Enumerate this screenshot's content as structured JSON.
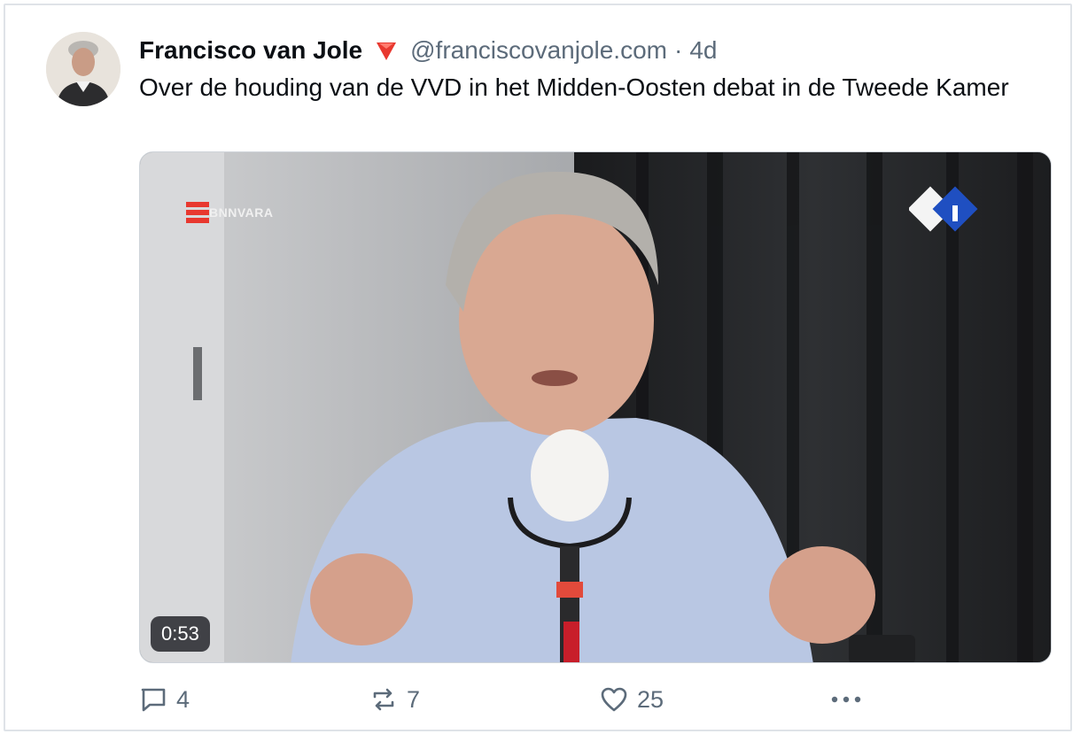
{
  "post": {
    "author": "Francisco van Jole",
    "handle": "@franciscovanjole.com",
    "separator": "·",
    "age": "4d",
    "text": "Over de houding van de VVD in het Midden-Oosten debat in de Tweede Kamer",
    "flag_color": "#e8382f"
  },
  "video": {
    "duration": "0:53",
    "watermark_left": "BNNVARA",
    "watermark_right_icon": "npo-radio-1-logo"
  },
  "actions": {
    "reply_count": "4",
    "repost_count": "7",
    "like_count": "25",
    "more_icon": "ellipsis-icon"
  },
  "colors": {
    "text": "#0b0f14",
    "muted": "#5c6b7a",
    "border": "#dfe3e8"
  }
}
